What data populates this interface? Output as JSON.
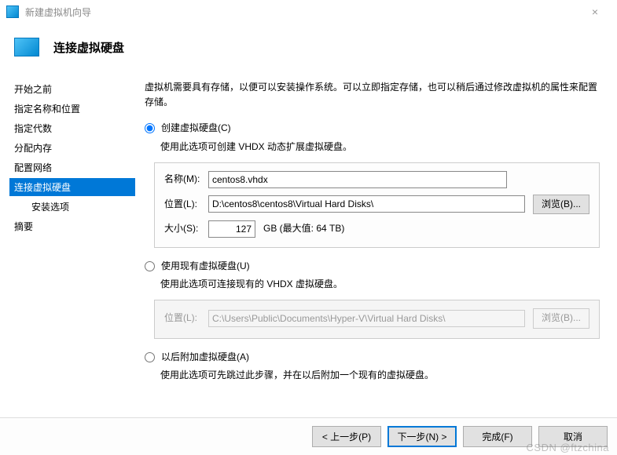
{
  "window": {
    "title": "新建虚拟机向导"
  },
  "header": {
    "title": "连接虚拟硬盘"
  },
  "sidebar": {
    "steps": [
      "开始之前",
      "指定名称和位置",
      "指定代数",
      "分配内存",
      "配置网络",
      "连接虚拟硬盘",
      "安装选项",
      "摘要"
    ],
    "selected_index": 5
  },
  "content": {
    "intro": "虚拟机需要具有存储，以便可以安装操作系统。可以立即指定存储，也可以稍后通过修改虚拟机的属性来配置存储。",
    "options": {
      "create": {
        "label": "创建虚拟硬盘(C)",
        "desc": "使用此选项可创建 VHDX 动态扩展虚拟硬盘。",
        "name_label": "名称(M):",
        "name_value": "centos8.vhdx",
        "loc_label": "位置(L):",
        "loc_value": "D:\\centos8\\centos8\\Virtual Hard Disks\\",
        "browse": "浏览(B)...",
        "size_label": "大小(S):",
        "size_value": "127",
        "size_suffix": "GB (最大值: 64 TB)"
      },
      "existing": {
        "label": "使用现有虚拟硬盘(U)",
        "desc": "使用此选项可连接现有的 VHDX 虚拟硬盘。",
        "loc_label": "位置(L):",
        "loc_value": "C:\\Users\\Public\\Documents\\Hyper-V\\Virtual Hard Disks\\",
        "browse": "浏览(B)..."
      },
      "later": {
        "label": "以后附加虚拟硬盘(A)",
        "desc": "使用此选项可先跳过此步骤，并在以后附加一个现有的虚拟硬盘。"
      },
      "selected": "create"
    }
  },
  "footer": {
    "prev": "< 上一步(P)",
    "next": "下一步(N) >",
    "finish": "完成(F)",
    "cancel": "取消"
  },
  "watermark": "CSDN @ftzchina"
}
